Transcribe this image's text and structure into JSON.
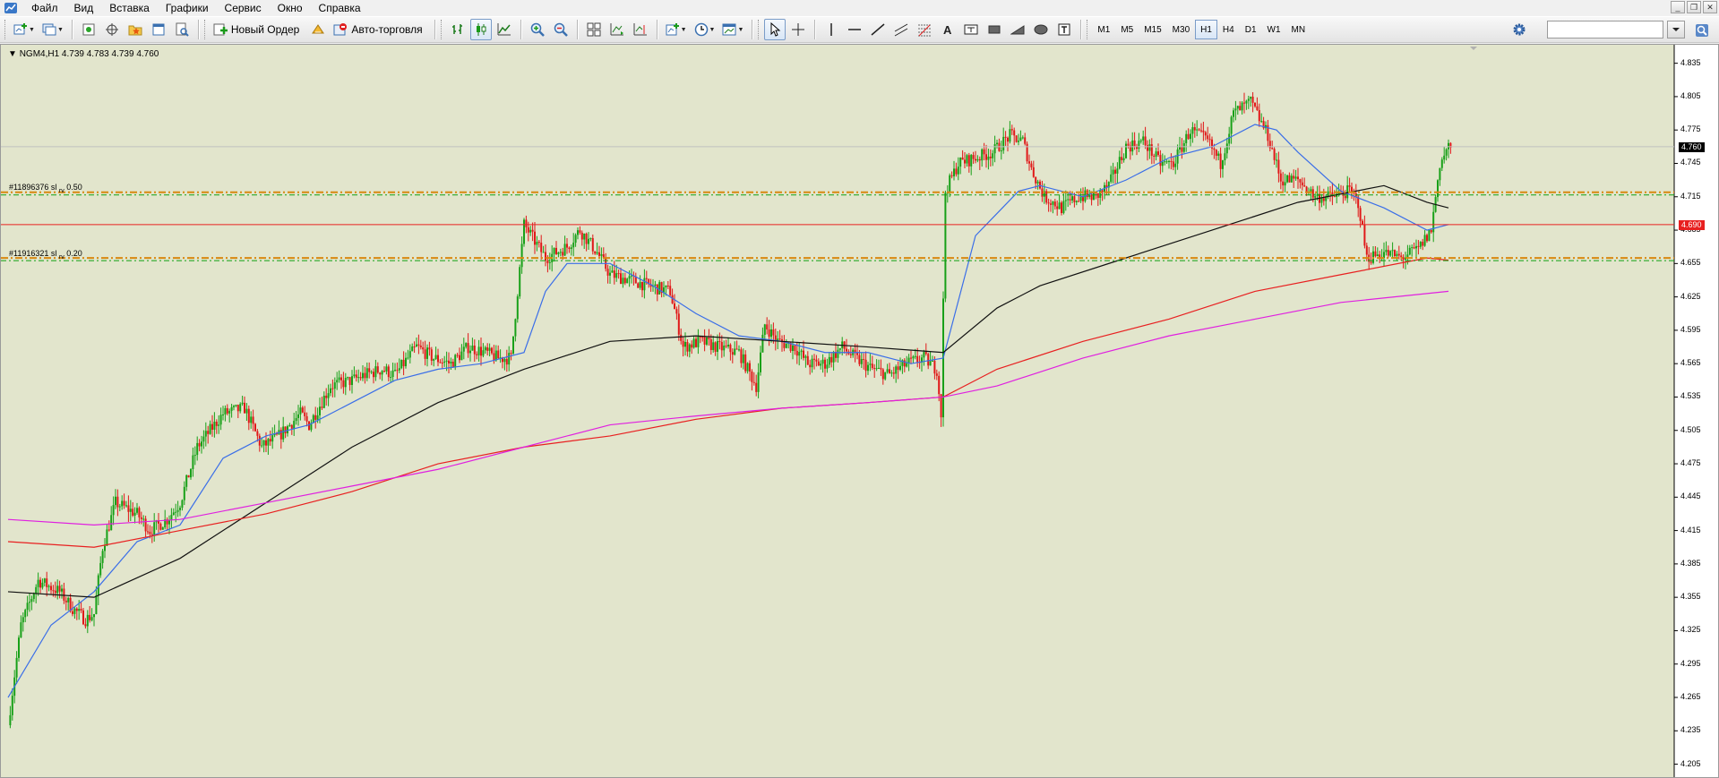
{
  "menu": {
    "items": [
      {
        "label": "Файл",
        "key": "file"
      },
      {
        "label": "Вид",
        "key": "view"
      },
      {
        "label": "Вставка",
        "key": "insert"
      },
      {
        "label": "Графики",
        "key": "charts"
      },
      {
        "label": "Сервис",
        "key": "tools"
      },
      {
        "label": "Окно",
        "key": "window"
      },
      {
        "label": "Справка",
        "key": "help"
      }
    ]
  },
  "toolbar": {
    "new_order_label": "Новый Ордер",
    "autotrading_label": "Авто-торговля",
    "timeframes": [
      "M1",
      "M5",
      "M15",
      "M30",
      "H1",
      "H4",
      "D1",
      "W1",
      "MN"
    ],
    "active_timeframe": "H1",
    "search_value": ""
  },
  "chart": {
    "header": "NGM4,H1  4.739 4.783 4.739 4.760",
    "background": "#e2e5cc",
    "current_price": "4.760",
    "line_price": "4.690",
    "orders": [
      {
        "label_main": "#11896376 sl",
        "label_sub": "rv",
        "label_tail": "0.50"
      },
      {
        "label_main": "#11916321 sl",
        "label_sub": "rv",
        "label_tail": "0.20"
      }
    ],
    "price_ticks": [
      "4.835",
      "4.805",
      "4.775",
      "4.745",
      "4.715",
      "4.685",
      "4.655",
      "4.625",
      "4.595",
      "4.565",
      "4.535",
      "4.505",
      "4.475",
      "4.445",
      "4.415",
      "4.385",
      "4.355",
      "4.325",
      "4.295",
      "4.265",
      "4.235",
      "4.205"
    ],
    "colors": {
      "bull": "#18a018",
      "bear": "#e01818",
      "ma_blue": "#3a6ee8",
      "ma_black": "#111111",
      "ma_red": "#e82020",
      "ma_magenta": "#e020e0",
      "order_orange": "#d88810",
      "order_green": "#10a010",
      "price_line_red": "#e82020",
      "bid_line": "#c0c0c0"
    }
  },
  "chart_data": {
    "type": "candlestick",
    "symbol": "NGM4",
    "timeframe": "H1",
    "ylim": [
      4.195,
      4.85
    ],
    "horizontal_levels": [
      {
        "kind": "order_sl",
        "label": "#11896376 sl",
        "value": 4.719
      },
      {
        "kind": "order_sl",
        "label": "#11916321 sl",
        "value": 4.66
      },
      {
        "kind": "price_line",
        "value": 4.69
      },
      {
        "kind": "bid",
        "value": 4.76
      }
    ],
    "segments": [
      [
        0,
        4.24
      ],
      [
        6,
        4.33
      ],
      [
        14,
        4.37
      ],
      [
        24,
        4.36
      ],
      [
        30,
        4.345
      ],
      [
        36,
        4.335
      ],
      [
        40,
        4.34
      ],
      [
        44,
        4.4
      ],
      [
        50,
        4.44
      ],
      [
        60,
        4.43
      ],
      [
        66,
        4.415
      ],
      [
        74,
        4.425
      ],
      [
        80,
        4.44
      ],
      [
        88,
        4.49
      ],
      [
        100,
        4.52
      ],
      [
        110,
        4.525
      ],
      [
        118,
        4.49
      ],
      [
        126,
        4.5
      ],
      [
        136,
        4.52
      ],
      [
        140,
        4.51
      ],
      [
        150,
        4.545
      ],
      [
        160,
        4.55
      ],
      [
        166,
        4.555
      ],
      [
        174,
        4.56
      ],
      [
        180,
        4.555
      ],
      [
        190,
        4.58
      ],
      [
        198,
        4.57
      ],
      [
        206,
        4.565
      ],
      [
        214,
        4.58
      ],
      [
        222,
        4.575
      ],
      [
        228,
        4.57
      ],
      [
        234,
        4.57
      ],
      [
        240,
        4.69
      ],
      [
        250,
        4.66
      ],
      [
        260,
        4.67
      ],
      [
        266,
        4.685
      ],
      [
        274,
        4.665
      ],
      [
        280,
        4.645
      ],
      [
        290,
        4.64
      ],
      [
        298,
        4.635
      ],
      [
        308,
        4.63
      ],
      [
        314,
        4.58
      ],
      [
        322,
        4.585
      ],
      [
        330,
        4.58
      ],
      [
        340,
        4.575
      ],
      [
        348,
        4.545
      ],
      [
        352,
        4.6
      ],
      [
        358,
        4.585
      ],
      [
        366,
        4.58
      ],
      [
        372,
        4.565
      ],
      [
        380,
        4.565
      ],
      [
        388,
        4.58
      ],
      [
        394,
        4.57
      ],
      [
        402,
        4.56
      ],
      [
        410,
        4.555
      ],
      [
        418,
        4.565
      ],
      [
        426,
        4.57
      ],
      [
        432,
        4.56
      ],
      [
        434,
        4.52
      ],
      [
        436,
        4.72
      ],
      [
        442,
        4.745
      ],
      [
        450,
        4.75
      ],
      [
        458,
        4.755
      ],
      [
        466,
        4.77
      ],
      [
        472,
        4.765
      ],
      [
        476,
        4.74
      ],
      [
        482,
        4.715
      ],
      [
        490,
        4.705
      ],
      [
        498,
        4.715
      ],
      [
        506,
        4.715
      ],
      [
        512,
        4.725
      ],
      [
        520,
        4.76
      ],
      [
        528,
        4.765
      ],
      [
        536,
        4.745
      ],
      [
        542,
        4.745
      ],
      [
        550,
        4.775
      ],
      [
        558,
        4.765
      ],
      [
        564,
        4.745
      ],
      [
        570,
        4.79
      ],
      [
        578,
        4.8
      ],
      [
        586,
        4.77
      ],
      [
        592,
        4.73
      ],
      [
        600,
        4.73
      ],
      [
        608,
        4.715
      ],
      [
        616,
        4.715
      ],
      [
        624,
        4.72
      ],
      [
        628,
        4.71
      ],
      [
        632,
        4.66
      ],
      [
        640,
        4.665
      ],
      [
        648,
        4.66
      ],
      [
        656,
        4.668
      ],
      [
        662,
        4.685
      ],
      [
        666,
        4.745
      ],
      [
        670,
        4.76
      ]
    ],
    "moving_averages": [
      {
        "color": "blue",
        "values": [
          [
            0,
            4.265
          ],
          [
            20,
            4.33
          ],
          [
            40,
            4.36
          ],
          [
            60,
            4.405
          ],
          [
            80,
            4.42
          ],
          [
            100,
            4.48
          ],
          [
            120,
            4.5
          ],
          [
            140,
            4.51
          ],
          [
            160,
            4.53
          ],
          [
            180,
            4.55
          ],
          [
            200,
            4.56
          ],
          [
            220,
            4.565
          ],
          [
            240,
            4.575
          ],
          [
            250,
            4.63
          ],
          [
            260,
            4.655
          ],
          [
            280,
            4.655
          ],
          [
            300,
            4.635
          ],
          [
            320,
            4.61
          ],
          [
            340,
            4.59
          ],
          [
            360,
            4.585
          ],
          [
            380,
            4.575
          ],
          [
            400,
            4.575
          ],
          [
            420,
            4.565
          ],
          [
            435,
            4.57
          ],
          [
            450,
            4.68
          ],
          [
            460,
            4.7
          ],
          [
            470,
            4.72
          ],
          [
            480,
            4.725
          ],
          [
            500,
            4.715
          ],
          [
            520,
            4.73
          ],
          [
            540,
            4.75
          ],
          [
            560,
            4.76
          ],
          [
            580,
            4.78
          ],
          [
            590,
            4.775
          ],
          [
            600,
            4.755
          ],
          [
            620,
            4.72
          ],
          [
            640,
            4.705
          ],
          [
            660,
            4.685
          ],
          [
            670,
            4.69
          ]
        ]
      },
      {
        "color": "black",
        "values": [
          [
            0,
            4.36
          ],
          [
            40,
            4.355
          ],
          [
            80,
            4.39
          ],
          [
            120,
            4.44
          ],
          [
            160,
            4.49
          ],
          [
            200,
            4.53
          ],
          [
            240,
            4.56
          ],
          [
            280,
            4.585
          ],
          [
            320,
            4.59
          ],
          [
            360,
            4.585
          ],
          [
            400,
            4.58
          ],
          [
            435,
            4.575
          ],
          [
            460,
            4.615
          ],
          [
            480,
            4.635
          ],
          [
            520,
            4.66
          ],
          [
            560,
            4.685
          ],
          [
            600,
            4.71
          ],
          [
            640,
            4.725
          ],
          [
            660,
            4.71
          ],
          [
            670,
            4.705
          ]
        ]
      },
      {
        "color": "red",
        "values": [
          [
            0,
            4.405
          ],
          [
            40,
            4.4
          ],
          [
            80,
            4.415
          ],
          [
            120,
            4.43
          ],
          [
            160,
            4.45
          ],
          [
            200,
            4.475
          ],
          [
            240,
            4.49
          ],
          [
            280,
            4.5
          ],
          [
            320,
            4.515
          ],
          [
            360,
            4.525
          ],
          [
            400,
            4.53
          ],
          [
            435,
            4.535
          ],
          [
            460,
            4.56
          ],
          [
            500,
            4.585
          ],
          [
            540,
            4.605
          ],
          [
            580,
            4.63
          ],
          [
            620,
            4.645
          ],
          [
            660,
            4.66
          ],
          [
            670,
            4.658
          ]
        ]
      },
      {
        "color": "magenta",
        "values": [
          [
            0,
            4.425
          ],
          [
            40,
            4.42
          ],
          [
            80,
            4.425
          ],
          [
            120,
            4.44
          ],
          [
            160,
            4.455
          ],
          [
            200,
            4.47
          ],
          [
            240,
            4.49
          ],
          [
            280,
            4.51
          ],
          [
            320,
            4.518
          ],
          [
            360,
            4.525
          ],
          [
            400,
            4.53
          ],
          [
            435,
            4.535
          ],
          [
            460,
            4.545
          ],
          [
            500,
            4.57
          ],
          [
            540,
            4.59
          ],
          [
            580,
            4.605
          ],
          [
            620,
            4.62
          ],
          [
            670,
            4.63
          ]
        ]
      }
    ]
  }
}
